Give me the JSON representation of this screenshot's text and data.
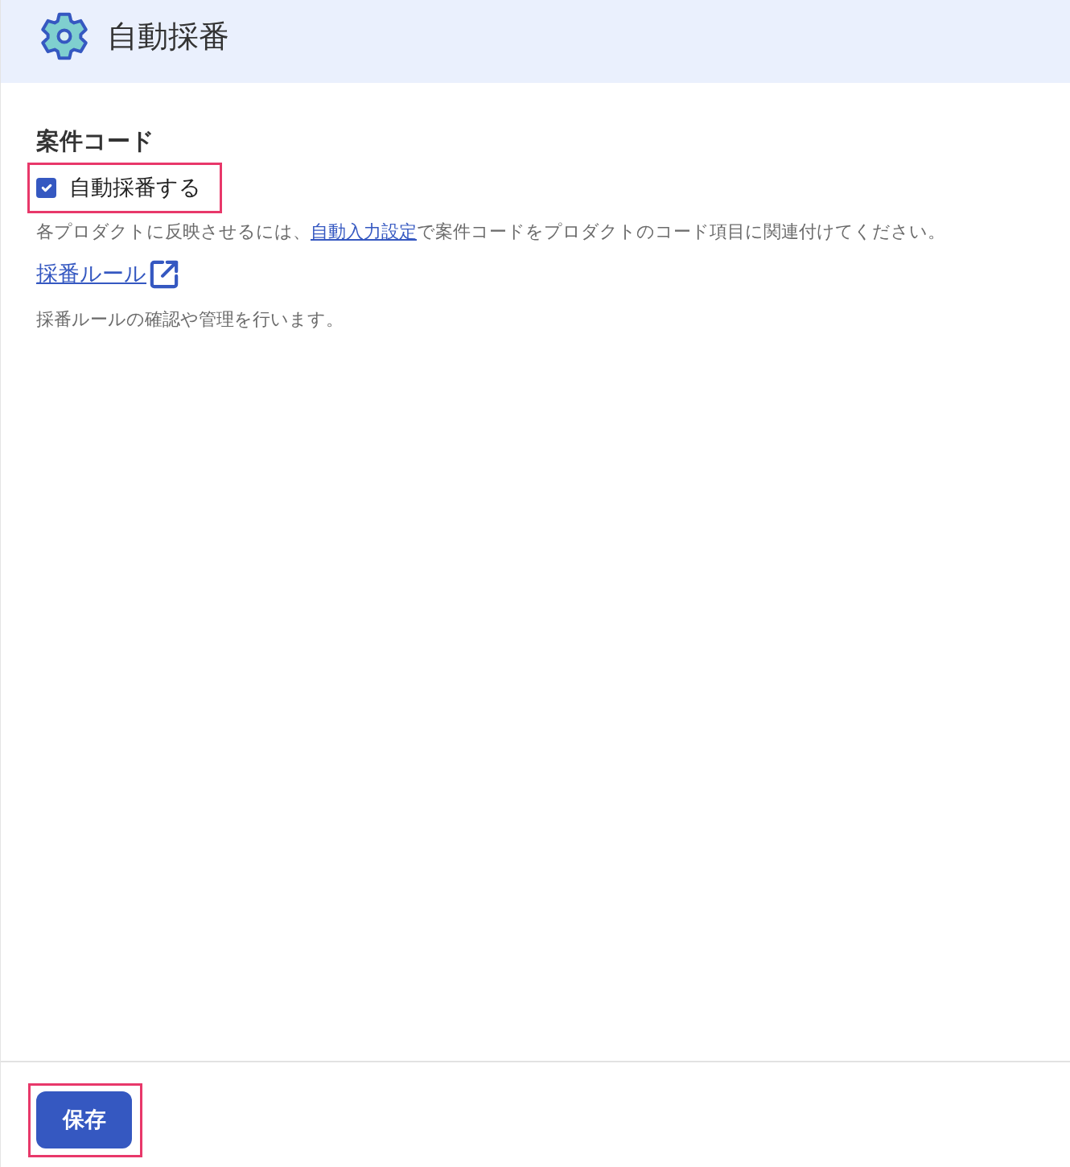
{
  "header": {
    "title": "自動採番"
  },
  "section": {
    "heading": "案件コード",
    "checkbox": {
      "label": "自動採番する",
      "checked": true,
      "highlighted": true
    },
    "help_text": {
      "before": "各プロダクトに反映させるには、",
      "link": "自動入力設定",
      "after": "で案件コードをプロダクトのコード項目に関連付けてください。"
    },
    "rule_link": {
      "label": "採番ルール"
    },
    "rule_description": "採番ルールの確認や管理を行います。"
  },
  "footer": {
    "save_button": {
      "label": "保存",
      "highlighted": true
    }
  }
}
